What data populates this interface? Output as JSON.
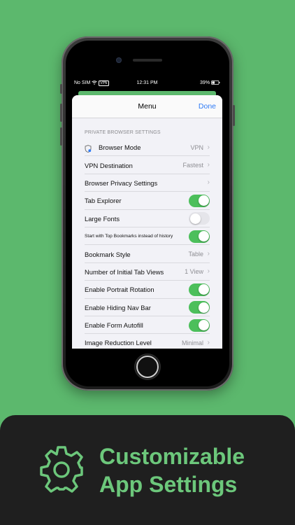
{
  "status_bar": {
    "carrier": "No SIM",
    "vpn_badge": "VPN",
    "time": "12:31 PM",
    "battery": "39%"
  },
  "sheet": {
    "title": "Menu",
    "done_label": "Done",
    "section_header": "PRIVATE BROWSER SETTINGS",
    "rows": [
      {
        "label": "Browser Mode",
        "value": "VPN",
        "icon": "shield-icon"
      },
      {
        "label": "VPN Destination",
        "value": "Fastest"
      },
      {
        "label": "Browser Privacy Settings"
      },
      {
        "label": "Tab Explorer",
        "toggle": true
      },
      {
        "label": "Large Fonts",
        "toggle": false
      },
      {
        "label": "Start with Top Bookmarks instead of history",
        "toggle": true
      },
      {
        "label": "Bookmark Style",
        "value": "Table"
      },
      {
        "label": "Number of Initial Tab Views",
        "value": "1 View"
      },
      {
        "label": "Enable Portrait Rotation",
        "toggle": true
      },
      {
        "label": "Enable Hiding Nav Bar",
        "toggle": true
      },
      {
        "label": "Enable Form Autofill",
        "toggle": true
      },
      {
        "label": "Image Reduction Level",
        "value": "Minimal"
      }
    ]
  },
  "banner": {
    "line1": "Customizable",
    "line2": "App Settings",
    "icon": "gear-icon"
  },
  "colors": {
    "background": "#5cb86d",
    "accent_green": "#4cbf5b",
    "link_blue": "#2f7bf5",
    "banner_bg": "#1f1f1f",
    "banner_text": "#6cc77b"
  }
}
